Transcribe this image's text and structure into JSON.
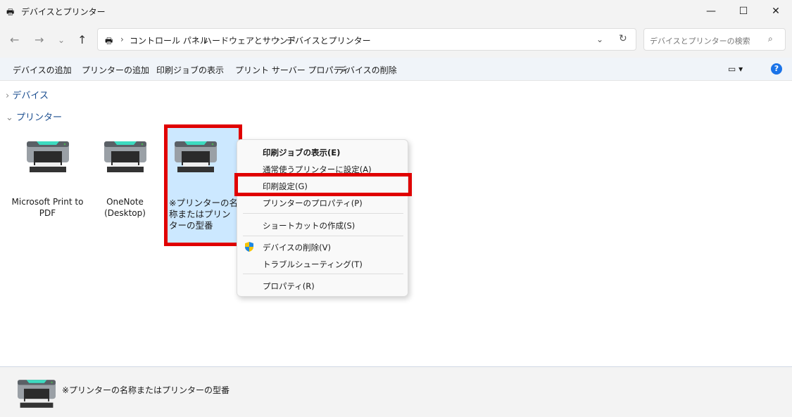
{
  "window": {
    "title": "デバイスとプリンター",
    "minimize": "—",
    "maximize": "☐",
    "close": "✕"
  },
  "address": {
    "crumbs": [
      "コントロール パネル",
      "ハードウェアとサウンド",
      "デバイスとプリンター"
    ],
    "search_placeholder": "デバイスとプリンターの検索"
  },
  "toolbar": {
    "items": [
      "デバイスの追加",
      "プリンターの追加",
      "印刷ジョブの表示",
      "プリント サーバー プロパティ",
      "デバイスの削除"
    ]
  },
  "groups": {
    "devices": "デバイス",
    "printers": "プリンター"
  },
  "printers": [
    {
      "name": "Microsoft Print to PDF"
    },
    {
      "name": "OneNote (Desktop)"
    },
    {
      "name": "※プリンターの名称またはプリンターの型番"
    }
  ],
  "context_menu": [
    "印刷ジョブの表示(E)",
    "通常使うプリンターに設定(A)",
    "印刷設定(G)",
    "プリンターのプロパティ(P)",
    "ショートカットの作成(S)",
    "デバイスの削除(V)",
    "トラブルシューティング(T)",
    "プロパティ(R)"
  ],
  "details": {
    "name": "※プリンターの名称またはプリンターの型番"
  },
  "colors": {
    "highlight": "#e00000",
    "selection": "#cce8ff"
  }
}
